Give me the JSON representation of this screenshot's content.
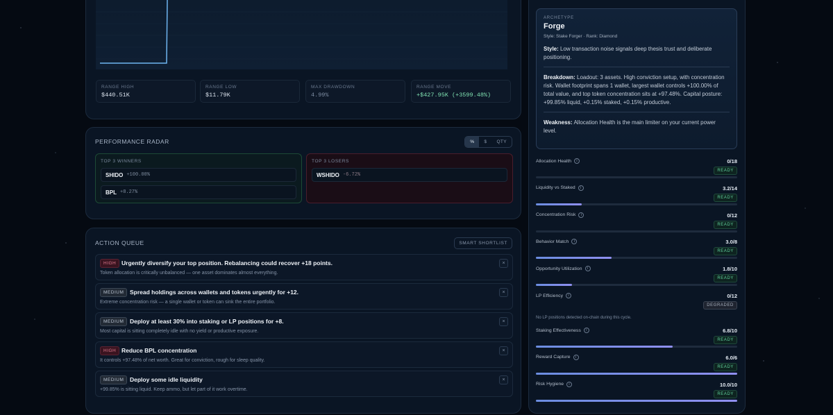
{
  "chart": {
    "stats": [
      {
        "label": "RANGE HIGH",
        "value": "$440.51K"
      },
      {
        "label": "RANGE LOW",
        "value": "$11.79K"
      },
      {
        "label": "MAX DRAWDOWN",
        "value": "4.99%"
      },
      {
        "label": "RANGE MOVE",
        "value": "+$427.95K (+3599.48%)"
      }
    ],
    "accent": "#6fb6f2"
  },
  "radar": {
    "title": "PERFORMANCE RADAR",
    "toggle": [
      "%",
      "$",
      "QTY"
    ],
    "winners_title": "TOP 3 WINNERS",
    "losers_title": "TOP 3 LOSERS",
    "winners": [
      {
        "symbol": "SHIDO",
        "pct": "+100.00%"
      },
      {
        "symbol": "BPL",
        "pct": "+8.27%"
      }
    ],
    "losers": [
      {
        "symbol": "WSHIDO",
        "pct": "-6.72%"
      }
    ]
  },
  "queue": {
    "title": "ACTION QUEUE",
    "shortlist_label": "SMART SHORTLIST",
    "close_glyph": "×",
    "items": [
      {
        "priority": "HIGH",
        "title": "Urgently diversify your top position. Rebalancing could recover +18 points.",
        "desc": "Token allocation is critically unbalanced — one asset dominates almost everything."
      },
      {
        "priority": "MEDIUM",
        "title": "Spread holdings across wallets and tokens urgently for +12.",
        "desc": "Extreme concentration risk — a single wallet or token can sink the entire portfolio."
      },
      {
        "priority": "MEDIUM",
        "title": "Deploy at least 30% into staking or LP positions for +8.",
        "desc": "Most capital is sitting completely idle with no yield or productive exposure."
      },
      {
        "priority": "HIGH",
        "title": "Reduce BPL concentration",
        "desc": "It controls +97.48% of net worth. Great for conviction, rough for sleep quality."
      },
      {
        "priority": "MEDIUM",
        "title": "Deploy some idle liquidity",
        "desc": "+99.85% is sitting liquid. Keep ammo, but let part of it work overtime."
      }
    ]
  },
  "archetype": {
    "label": "ARCHETYPE",
    "name": "Forge",
    "meta": "Style: Stake Forger · Rank: Diamond",
    "style_label": "Style:",
    "style_text": "Low transaction noise signals deep thesis trust and deliberate positioning.",
    "breakdown_label": "Breakdown:",
    "breakdown_text": "Loadout: 3 assets. High conviction setup, with concentration risk. Wallet footprint spans 1 wallet, largest wallet controls +100.00% of total value, and top token concentration sits at +97.48%. Capital posture: +99.85% liquid, +0.15% staked, +0.15% productive.",
    "weakness_label": "Weakness:",
    "weakness_text": "Allocation Health is the main limiter on your current power level."
  },
  "metrics": [
    {
      "name": "Allocation Health",
      "value": "0/18",
      "status": "READY",
      "fraction": 0.0
    },
    {
      "name": "Liquidity vs Staked",
      "value": "3.2/14",
      "status": "READY",
      "fraction": 0.2286
    },
    {
      "name": "Concentration Risk",
      "value": "0/12",
      "status": "READY",
      "fraction": 0.0
    },
    {
      "name": "Behavior Match",
      "value": "3.0/8",
      "status": "READY",
      "fraction": 0.375
    },
    {
      "name": "Opportunity Utilization",
      "value": "1.8/10",
      "status": "READY",
      "fraction": 0.18
    },
    {
      "name": "LP Efficiency",
      "value": "0/12",
      "status": "DEGRADED",
      "fraction": 0.0,
      "note": "No LP positions detected on-chain during this cycle."
    },
    {
      "name": "Staking Effectiveness",
      "value": "6.8/10",
      "status": "READY",
      "fraction": 0.68
    },
    {
      "name": "Reward Capture",
      "value": "6.0/6",
      "status": "READY",
      "fraction": 1.0
    },
    {
      "name": "Risk Hygiene",
      "value": "10.0/10",
      "status": "READY",
      "fraction": 1.0
    }
  ],
  "info_glyph": "i"
}
